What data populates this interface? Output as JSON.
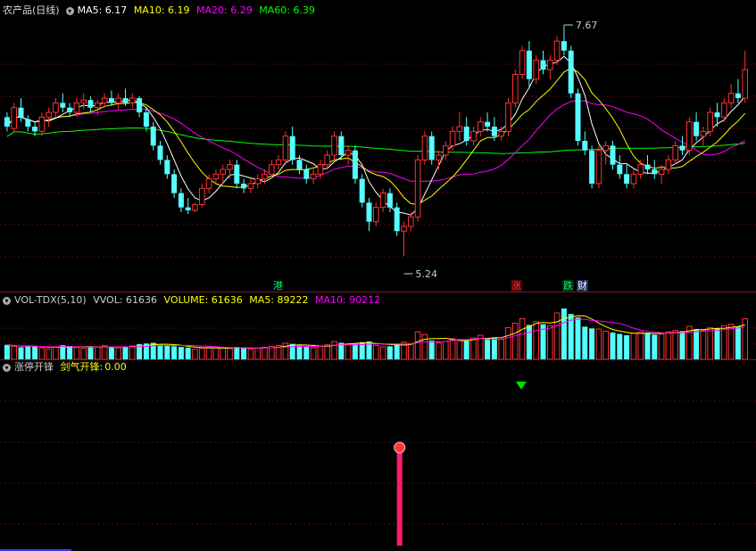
{
  "price_panel": {
    "title": "农产品(日线)",
    "ma5_label": "MA5: 6.17",
    "ma10_label": "MA10: 6.19",
    "ma20_label": "MA20: 6.29",
    "ma60_label": "MA60: 6.39",
    "high_label": "7.67",
    "low_label": "5.24",
    "tag_gang": "港",
    "tag_zhang": "涨",
    "tag_die": "跌",
    "tag_cai": "财",
    "colors": {
      "up": "#ff3232",
      "down": "#54ffff",
      "ma5": "#ffffff",
      "ma10": "#ffff00",
      "ma20": "#ff00ff",
      "ma60": "#00ff00"
    }
  },
  "volume_panel": {
    "title": "VOL-TDX(5,10)",
    "vvol_label": "VVOL: 61636",
    "volume_label": "VOLUME: 61636",
    "ma5_label": "MA5: 89222",
    "ma10_label": "MA10: 90212"
  },
  "indicator_panel": {
    "title": "涨停开锋",
    "name_label": "剑气开锋:",
    "value_label": "0.00"
  },
  "chart_data": {
    "type": "candlestick",
    "candles": [
      [
        6.7,
        6.75,
        6.55,
        6.6
      ],
      [
        6.58,
        6.85,
        6.55,
        6.8
      ],
      [
        6.8,
        6.9,
        6.65,
        6.7
      ],
      [
        6.68,
        6.72,
        6.55,
        6.6
      ],
      [
        6.6,
        6.65,
        6.5,
        6.55
      ],
      [
        6.55,
        6.75,
        6.5,
        6.7
      ],
      [
        6.7,
        6.8,
        6.6,
        6.75
      ],
      [
        6.75,
        6.9,
        6.7,
        6.85
      ],
      [
        6.85,
        6.95,
        6.75,
        6.8
      ],
      [
        6.8,
        6.85,
        6.7,
        6.75
      ],
      [
        6.75,
        6.9,
        6.7,
        6.85
      ],
      [
        6.85,
        6.95,
        6.78,
        6.88
      ],
      [
        6.88,
        6.92,
        6.75,
        6.8
      ],
      [
        6.8,
        6.88,
        6.72,
        6.85
      ],
      [
        6.85,
        6.95,
        6.8,
        6.9
      ],
      [
        6.9,
        6.98,
        6.82,
        6.85
      ],
      [
        6.85,
        6.95,
        6.78,
        6.9
      ],
      [
        6.9,
        7.0,
        6.82,
        6.85
      ],
      [
        6.85,
        6.95,
        6.8,
        6.9
      ],
      [
        6.9,
        6.92,
        6.7,
        6.75
      ],
      [
        6.75,
        6.8,
        6.55,
        6.6
      ],
      [
        6.6,
        6.65,
        6.35,
        6.4
      ],
      [
        6.4,
        6.45,
        6.2,
        6.25
      ],
      [
        6.25,
        6.3,
        6.05,
        6.1
      ],
      [
        6.1,
        6.15,
        5.85,
        5.9
      ],
      [
        5.9,
        5.95,
        5.7,
        5.75
      ],
      [
        5.75,
        5.85,
        5.68,
        5.72
      ],
      [
        5.72,
        5.8,
        5.7,
        5.78
      ],
      [
        5.78,
        6.0,
        5.75,
        5.95
      ],
      [
        5.95,
        6.1,
        5.9,
        6.05
      ],
      [
        6.05,
        6.15,
        6.0,
        6.1
      ],
      [
        6.1,
        6.2,
        6.0,
        6.15
      ],
      [
        6.15,
        6.25,
        6.05,
        6.2
      ],
      [
        6.2,
        6.25,
        5.95,
        6.0
      ],
      [
        6.0,
        6.05,
        5.9,
        5.95
      ],
      [
        5.95,
        6.05,
        5.9,
        6.0
      ],
      [
        6.0,
        6.1,
        5.95,
        6.05
      ],
      [
        6.05,
        6.15,
        6.0,
        6.1
      ],
      [
        6.1,
        6.25,
        6.05,
        6.2
      ],
      [
        6.2,
        6.3,
        6.15,
        6.25
      ],
      [
        6.25,
        6.55,
        6.2,
        6.5
      ],
      [
        6.5,
        6.6,
        6.2,
        6.25
      ],
      [
        6.25,
        6.3,
        6.1,
        6.15
      ],
      [
        6.15,
        6.2,
        6.0,
        6.05
      ],
      [
        6.05,
        6.15,
        6.0,
        6.1
      ],
      [
        6.1,
        6.25,
        6.05,
        6.2
      ],
      [
        6.2,
        6.35,
        6.15,
        6.3
      ],
      [
        6.3,
        6.55,
        6.25,
        6.5
      ],
      [
        6.5,
        6.55,
        6.25,
        6.3
      ],
      [
        6.3,
        6.4,
        6.2,
        6.35
      ],
      [
        6.35,
        6.4,
        6.0,
        6.05
      ],
      [
        6.05,
        6.1,
        5.75,
        5.8
      ],
      [
        5.8,
        5.85,
        5.5,
        5.6
      ],
      [
        5.6,
        5.8,
        5.55,
        5.75
      ],
      [
        5.75,
        5.95,
        5.7,
        5.9
      ],
      [
        5.9,
        5.95,
        5.7,
        5.75
      ],
      [
        5.75,
        5.8,
        5.45,
        5.5
      ],
      [
        5.5,
        5.6,
        5.24,
        5.55
      ],
      [
        5.55,
        5.7,
        5.5,
        5.65
      ],
      [
        5.65,
        6.3,
        5.6,
        6.25
      ],
      [
        6.25,
        6.55,
        6.2,
        6.5
      ],
      [
        6.5,
        6.55,
        6.2,
        6.25
      ],
      [
        6.25,
        6.35,
        6.15,
        6.3
      ],
      [
        6.3,
        6.45,
        6.25,
        6.4
      ],
      [
        6.4,
        6.6,
        6.35,
        6.55
      ],
      [
        6.55,
        6.75,
        6.45,
        6.6
      ],
      [
        6.6,
        6.7,
        6.4,
        6.45
      ],
      [
        6.45,
        6.6,
        6.4,
        6.55
      ],
      [
        6.55,
        6.7,
        6.5,
        6.65
      ],
      [
        6.65,
        6.75,
        6.55,
        6.6
      ],
      [
        6.6,
        6.7,
        6.45,
        6.5
      ],
      [
        6.5,
        6.6,
        6.45,
        6.55
      ],
      [
        6.55,
        6.9,
        6.5,
        6.85
      ],
      [
        6.85,
        7.2,
        6.8,
        7.15
      ],
      [
        7.15,
        7.45,
        7.1,
        7.4
      ],
      [
        7.4,
        7.5,
        7.0,
        7.1
      ],
      [
        7.1,
        7.35,
        7.05,
        7.3
      ],
      [
        7.3,
        7.4,
        7.15,
        7.2
      ],
      [
        7.2,
        7.35,
        7.1,
        7.3
      ],
      [
        7.3,
        7.55,
        7.25,
        7.5
      ],
      [
        7.5,
        7.67,
        7.35,
        7.4
      ],
      [
        7.4,
        7.45,
        6.9,
        6.95
      ],
      [
        6.95,
        7.0,
        6.4,
        6.45
      ],
      [
        6.45,
        6.55,
        6.3,
        6.35
      ],
      [
        6.35,
        6.4,
        5.95,
        6.0
      ],
      [
        6.0,
        6.4,
        5.95,
        6.35
      ],
      [
        6.35,
        6.45,
        6.2,
        6.4
      ],
      [
        6.4,
        6.45,
        6.15,
        6.2
      ],
      [
        6.2,
        6.3,
        6.05,
        6.1
      ],
      [
        6.1,
        6.2,
        5.95,
        6.0
      ],
      [
        6.0,
        6.15,
        5.95,
        6.1
      ],
      [
        6.1,
        6.25,
        6.05,
        6.2
      ],
      [
        6.2,
        6.3,
        6.1,
        6.15
      ],
      [
        6.15,
        6.25,
        6.05,
        6.1
      ],
      [
        6.1,
        6.2,
        6.0,
        6.15
      ],
      [
        6.15,
        6.3,
        6.1,
        6.25
      ],
      [
        6.25,
        6.45,
        6.2,
        6.4
      ],
      [
        6.4,
        6.5,
        6.3,
        6.35
      ],
      [
        6.35,
        6.7,
        6.3,
        6.65
      ],
      [
        6.65,
        6.75,
        6.45,
        6.5
      ],
      [
        6.5,
        6.6,
        6.4,
        6.55
      ],
      [
        6.55,
        6.8,
        6.5,
        6.75
      ],
      [
        6.75,
        6.85,
        6.6,
        6.7
      ],
      [
        6.7,
        6.9,
        6.65,
        6.85
      ],
      [
        6.85,
        7.05,
        6.8,
        6.95
      ],
      [
        6.95,
        7.1,
        6.85,
        6.9
      ],
      [
        6.9,
        7.4,
        6.85,
        7.2
      ]
    ],
    "volumes": [
      42,
      38,
      35,
      40,
      37,
      33,
      30,
      36,
      41,
      39,
      34,
      32,
      38,
      36,
      40,
      35,
      33,
      37,
      39,
      44,
      46,
      48,
      42,
      40,
      38,
      36,
      34,
      30,
      32,
      35,
      34,
      33,
      31,
      36,
      34,
      30,
      32,
      35,
      38,
      40,
      47,
      45,
      40,
      36,
      34,
      38,
      42,
      52,
      48,
      44,
      45,
      50,
      52,
      40,
      36,
      38,
      44,
      50,
      46,
      80,
      72,
      55,
      48,
      52,
      60,
      58,
      54,
      62,
      70,
      62,
      64,
      58,
      92,
      105,
      118,
      100,
      110,
      102,
      98,
      135,
      148,
      132,
      122,
      95,
      90,
      88,
      82,
      78,
      74,
      70,
      76,
      80,
      78,
      72,
      74,
      80,
      84,
      82,
      96,
      88,
      84,
      92,
      90,
      98,
      102,
      96,
      118
    ],
    "price_range": [
      5.24,
      7.67
    ],
    "signal_arrow_index": 75,
    "signal_bar_index": 56
  }
}
